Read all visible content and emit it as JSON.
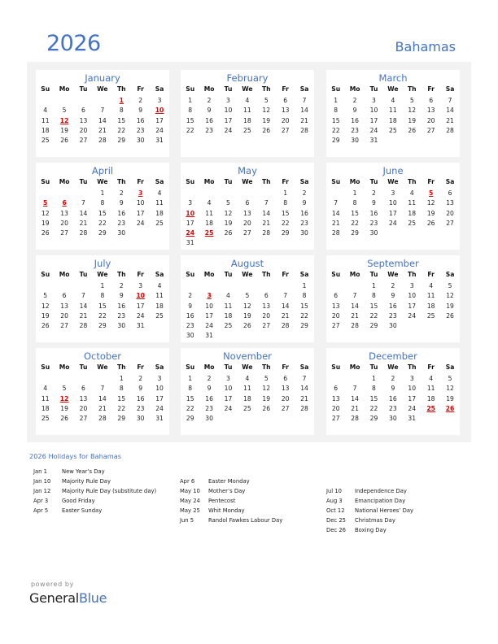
{
  "header": {
    "year": "2026",
    "country": "Bahamas"
  },
  "weekdays": [
    "Su",
    "Mo",
    "Tu",
    "We",
    "Th",
    "Fr",
    "Sa"
  ],
  "months": [
    {
      "name": "January",
      "start": 4,
      "days": 31,
      "holidays": [
        1,
        10,
        12
      ]
    },
    {
      "name": "February",
      "start": 0,
      "days": 28,
      "holidays": []
    },
    {
      "name": "March",
      "start": 0,
      "days": 31,
      "holidays": []
    },
    {
      "name": "April",
      "start": 3,
      "days": 30,
      "holidays": [
        3,
        5,
        6
      ]
    },
    {
      "name": "May",
      "start": 5,
      "days": 31,
      "holidays": [
        10,
        24,
        25
      ]
    },
    {
      "name": "June",
      "start": 1,
      "days": 30,
      "holidays": [
        5
      ]
    },
    {
      "name": "July",
      "start": 3,
      "days": 31,
      "holidays": [
        10
      ]
    },
    {
      "name": "August",
      "start": 6,
      "days": 31,
      "holidays": [
        3
      ]
    },
    {
      "name": "September",
      "start": 2,
      "days": 30,
      "holidays": []
    },
    {
      "name": "October",
      "start": 4,
      "days": 31,
      "holidays": [
        12
      ]
    },
    {
      "name": "November",
      "start": 0,
      "days": 30,
      "holidays": []
    },
    {
      "name": "December",
      "start": 2,
      "days": 31,
      "holidays": [
        25,
        26
      ]
    }
  ],
  "holidays_title": "2026 Holidays for Bahamas",
  "holiday_columns": [
    [
      {
        "date": "Jan 1",
        "name": "New Year’s Day"
      },
      {
        "date": "Jan 10",
        "name": "Majority Rule Day"
      },
      {
        "date": "Jan 12",
        "name": "Majority Rule Day (substitute day)"
      },
      {
        "date": "Apr 3",
        "name": "Good Friday"
      },
      {
        "date": "Apr 5",
        "name": "Easter Sunday"
      }
    ],
    [
      {
        "date": "Apr 6",
        "name": "Easter Monday"
      },
      {
        "date": "May 10",
        "name": "Mother’s Day"
      },
      {
        "date": "May 24",
        "name": "Pentecost"
      },
      {
        "date": "May 25",
        "name": "Whit Monday"
      },
      {
        "date": "Jun 5",
        "name": "Randol Fawkes Labour Day"
      }
    ],
    [
      {
        "date": "Jul 10",
        "name": "Independence Day"
      },
      {
        "date": "Aug 3",
        "name": "Emancipation Day"
      },
      {
        "date": "Oct 12",
        "name": "National Heroes’ Day"
      },
      {
        "date": "Dec 25",
        "name": "Christmas Day"
      },
      {
        "date": "Dec 26",
        "name": "Boxing Day"
      }
    ]
  ],
  "footer": {
    "powered_by": "powered by",
    "brand_general": "General",
    "brand_blue": "Blue"
  },
  "colors": {
    "accent": "#4472c4",
    "holiday": "#e00000",
    "panel_bg": "#f2f2f2"
  }
}
